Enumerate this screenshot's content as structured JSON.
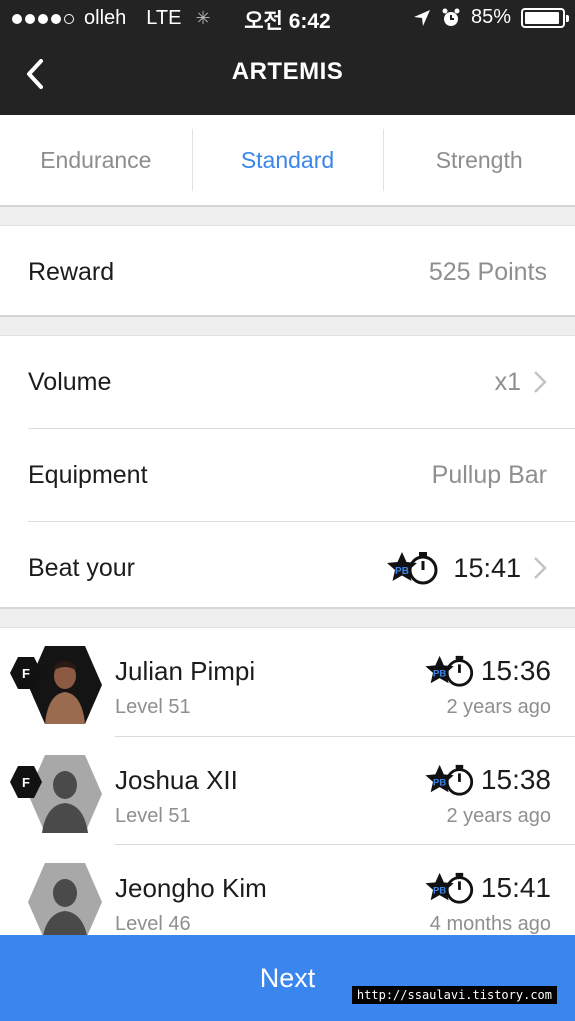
{
  "status": {
    "carrier": "olleh",
    "network": "LTE",
    "time": "오전 6:42",
    "battery": "85%",
    "battery_level": 0.85
  },
  "nav": {
    "title": "ARTEMIS"
  },
  "tabs": [
    {
      "label": "Endurance"
    },
    {
      "label": "Standard",
      "active": true
    },
    {
      "label": "Strength"
    }
  ],
  "reward": {
    "label": "Reward",
    "value": "525 Points"
  },
  "settings": {
    "volume": {
      "label": "Volume",
      "value": "x1"
    },
    "equipment": {
      "label": "Equipment",
      "value": "Pullup Bar"
    },
    "beat": {
      "label": "Beat your",
      "value": "15:41",
      "badge": "PB"
    }
  },
  "leaderboard": [
    {
      "name": "Julian Pimpi",
      "level": "Level 51",
      "time": "15:36",
      "ago": "2 years ago",
      "friend": "F",
      "badge": "PB"
    },
    {
      "name": "Joshua XII",
      "level": "Level 51",
      "time": "15:38",
      "ago": "2 years ago",
      "friend": "F",
      "badge": "PB"
    },
    {
      "name": "Jeongho Kim",
      "level": "Level 46",
      "time": "15:41",
      "ago": "4 months ago",
      "badge": "PB"
    }
  ],
  "next_label": "Next",
  "watermark": "http://ssaulavi.tistory.com",
  "colors": {
    "accent": "#3a86e8",
    "nav_bg": "#232323",
    "button": "#3b85ee"
  }
}
